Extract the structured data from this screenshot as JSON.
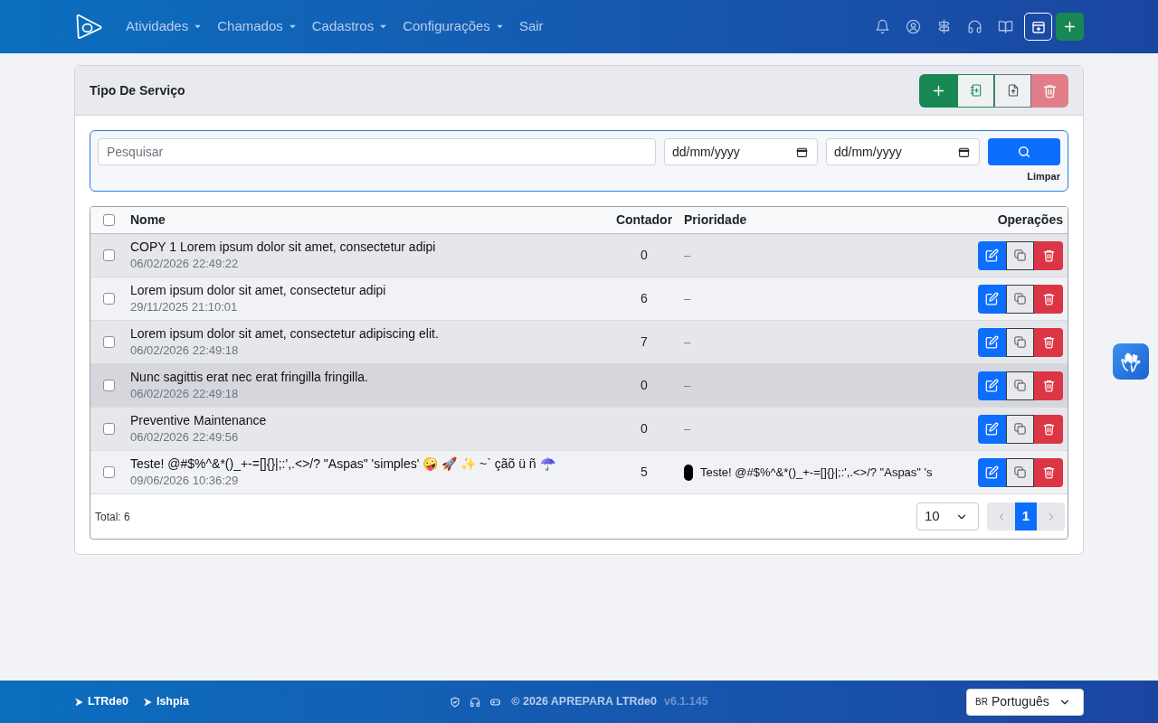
{
  "header": {
    "nav": [
      {
        "label": "Atividades",
        "dropdown": true
      },
      {
        "label": "Chamados",
        "dropdown": true
      },
      {
        "label": "Cadastros",
        "dropdown": true
      },
      {
        "label": "Configurações",
        "dropdown": true
      },
      {
        "label": "Sair",
        "dropdown": false
      }
    ]
  },
  "page": {
    "title": "Tipo De Serviço",
    "delete_selected": {
      "disabled": true
    }
  },
  "filters": {
    "search": {
      "placeholder": "Pesquisar"
    },
    "date_from": {
      "placeholder": "dd/mm/yyyy"
    },
    "date_to": {
      "placeholder": "dd/mm/yyyy"
    },
    "clear_label": "Limpar"
  },
  "table": {
    "select_all": {
      "checked": false
    },
    "columns": [
      "Nome",
      "Contador",
      "Prioridade",
      "Operações"
    ],
    "rows": [
      {
        "name": "COPY 1 Lorem ipsum dolor sit amet, consectetur adipi",
        "date": "06/02/2026 22:49:22",
        "counter": "0",
        "priority": {
          "label": "–"
        },
        "checked": false,
        "hovered": false
      },
      {
        "name": "Lorem ipsum dolor sit amet, consectetur adipi",
        "date": "29/11/2025 21:10:01",
        "counter": "6",
        "priority": {
          "label": "–"
        },
        "checked": false,
        "hovered": false
      },
      {
        "name": "Lorem ipsum dolor sit amet, consectetur adipiscing elit.",
        "date": "06/02/2026 22:49:18",
        "counter": "7",
        "priority": {
          "label": "–"
        },
        "checked": false,
        "hovered": false
      },
      {
        "name": "Nunc sagittis erat nec erat fringilla fringilla.",
        "date": "06/02/2026 22:49:18",
        "counter": "0",
        "priority": {
          "label": "–"
        },
        "checked": false,
        "hovered": true
      },
      {
        "name": "Preventive Maintenance",
        "date": "06/02/2026 22:49:56",
        "counter": "0",
        "priority": {
          "label": "–"
        },
        "checked": false,
        "hovered": false
      },
      {
        "name": "Teste! @#$%^&*()_+-=[]{}|;:',.<>/? \"Aspas\" 'simples' 🤪 🚀 ✨ ~` çãõ ü ñ ☂️",
        "date": "09/06/2026 10:36:29",
        "counter": "5",
        "priority": {
          "label": "Teste! @#$%^&*()_+-=[]{}|;:',.<>/? \"Aspas\" 's",
          "color": "#000000"
        },
        "checked": false,
        "hovered": false
      }
    ],
    "total": "Total: 6",
    "page_size": "10",
    "pages": [
      {
        "label": "1",
        "selected": true
      }
    ]
  },
  "footer": {
    "links": [
      {
        "label": "LTRde0"
      },
      {
        "label": "Ishpia"
      }
    ],
    "copyright": "© 2026 APREPARA LTRde0",
    "version": "v6.1.145",
    "language": {
      "flag": "BR",
      "label": "Português"
    }
  }
}
